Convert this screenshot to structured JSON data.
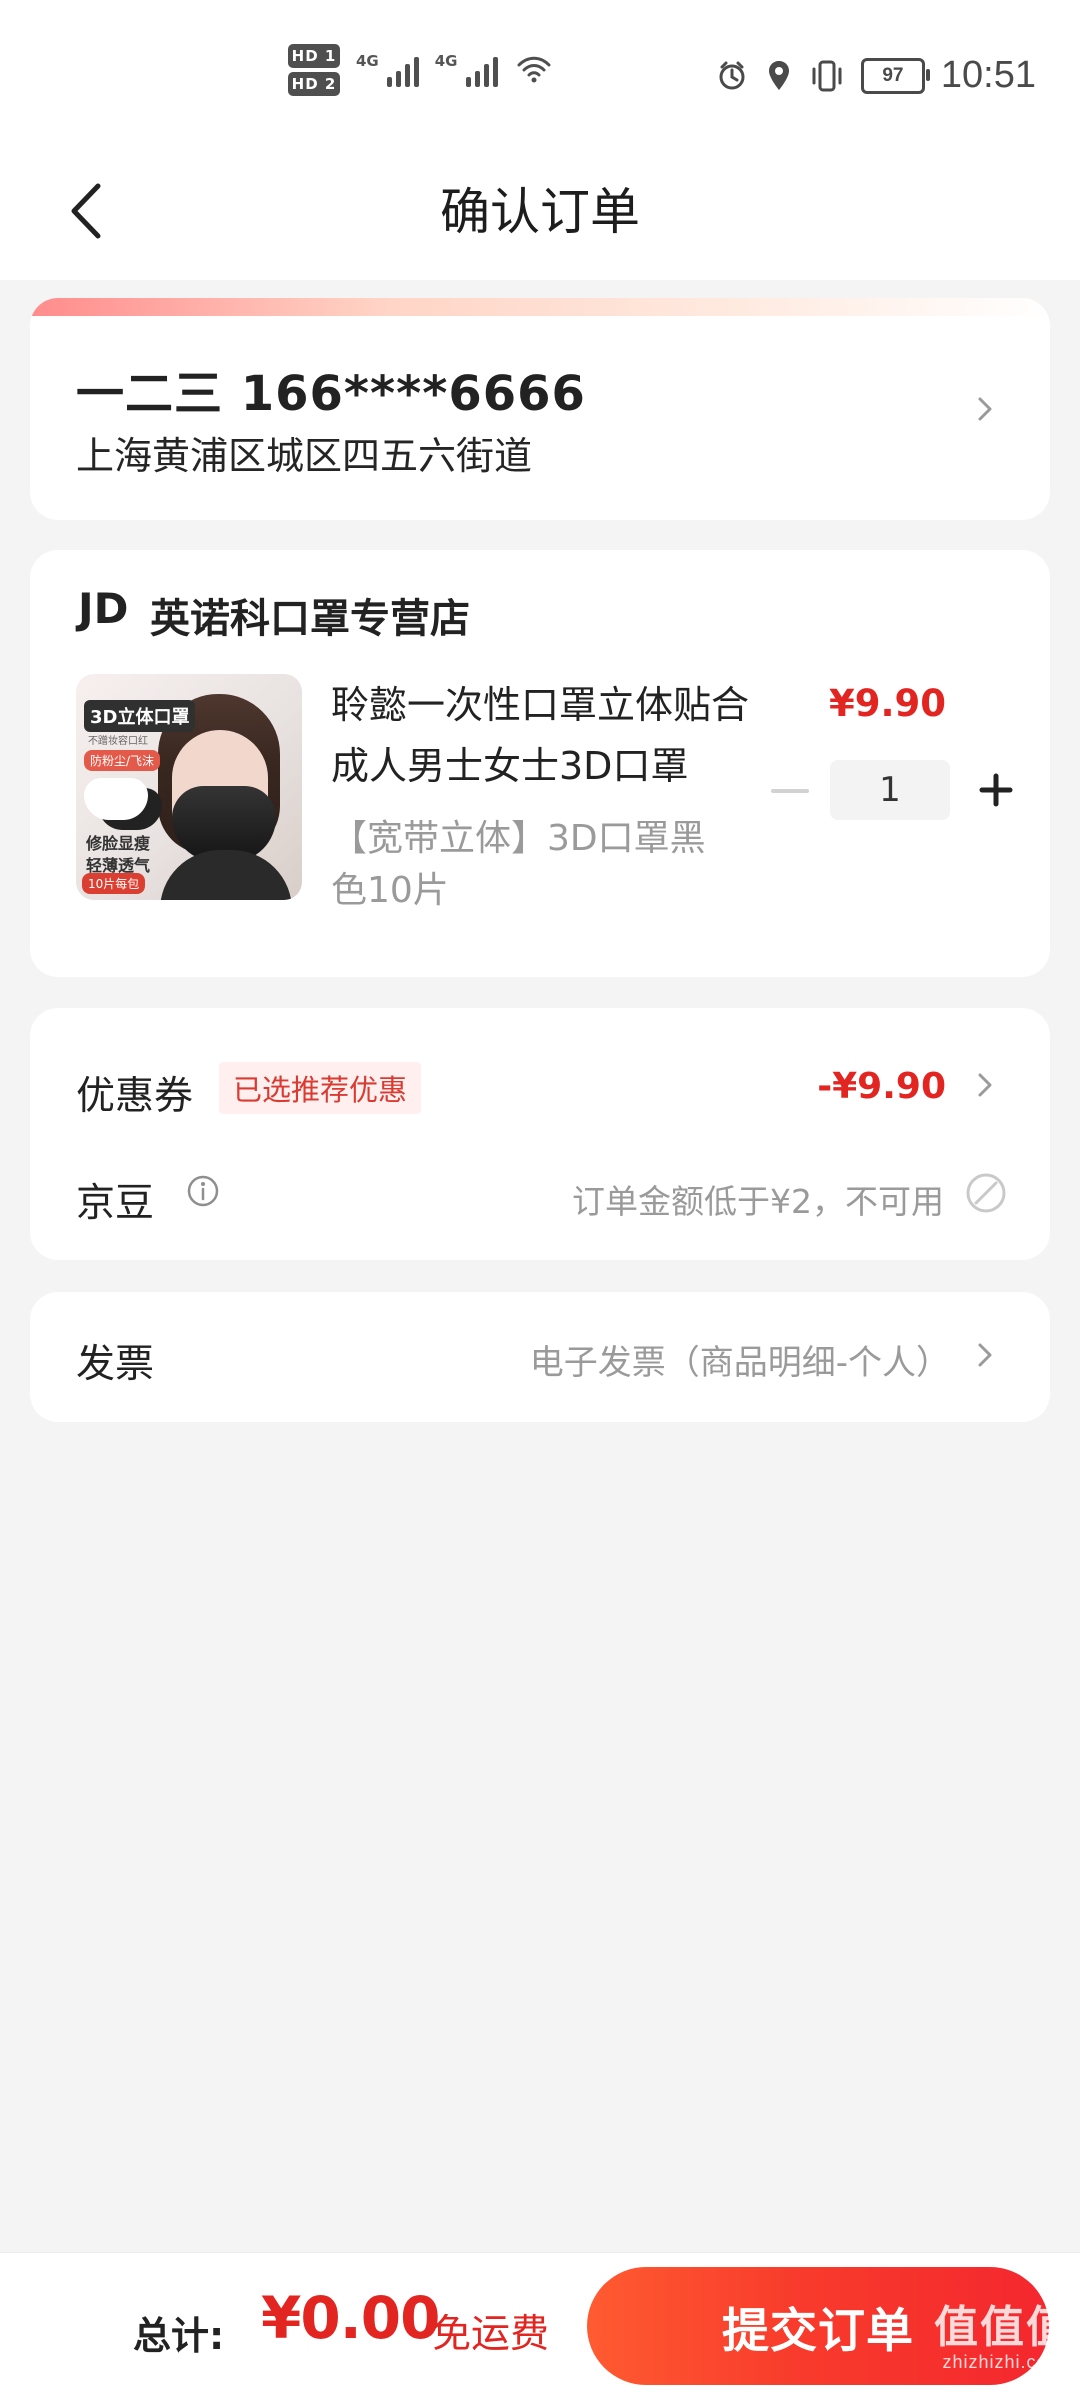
{
  "status_bar": {
    "time": "10:51",
    "battery": "97",
    "hd1": "HD 1",
    "hd2": "HD 2",
    "network1": "4G",
    "network2": "4G"
  },
  "header": {
    "title": "确认订单"
  },
  "address": {
    "name_phone": "一二三 166****6666",
    "line": "上海黄浦区城区四五六街道"
  },
  "store": {
    "logo": "JD",
    "name": "英诺科口罩专营店"
  },
  "product": {
    "title": "聆懿一次性口罩立体贴合 成人男士女士3D口罩",
    "spec": "【宽带立体】3D口罩黑色10片",
    "price": "¥9.90",
    "quantity": "1",
    "image_text": {
      "title": "3D立体口罩",
      "subtitle": "不蹭妆容口红",
      "tag1": "防粉尘/飞沫",
      "note1": "修脸显瘦",
      "note2": "轻薄透气",
      "tag2": "10片每包"
    }
  },
  "discount": {
    "coupon_label": "优惠券",
    "coupon_tag": "已选推荐优惠",
    "coupon_value": "-¥9.90",
    "bean_label": "京豆",
    "bean_note": "订单金额低于¥2，不可用"
  },
  "invoice": {
    "label": "发票",
    "value": "电子发票（商品明细-个人）"
  },
  "bottom": {
    "total_label": "总计:",
    "total_value": "¥0.00",
    "shipping": "免运费",
    "submit": "提交订单"
  },
  "watermark": {
    "main": "值值值",
    "sub": "zhizhizhi.com"
  },
  "icons": {
    "back": "back-arrow-icon",
    "chevron": "chevron-right-icon",
    "info": "info-icon",
    "disabled": "disabled-circle-icon",
    "plus": "plus-icon",
    "minus": "minus-icon",
    "alarm": "alarm-icon",
    "location": "location-icon",
    "vibrate": "vibrate-icon",
    "wifi": "wifi-icon"
  },
  "colors": {
    "accent_red": "#e22521",
    "submit_gradient_start": "#ff5b31",
    "submit_gradient_end": "#f4272e",
    "background": "#f4f4f4",
    "muted_text": "#9a9a9a"
  }
}
